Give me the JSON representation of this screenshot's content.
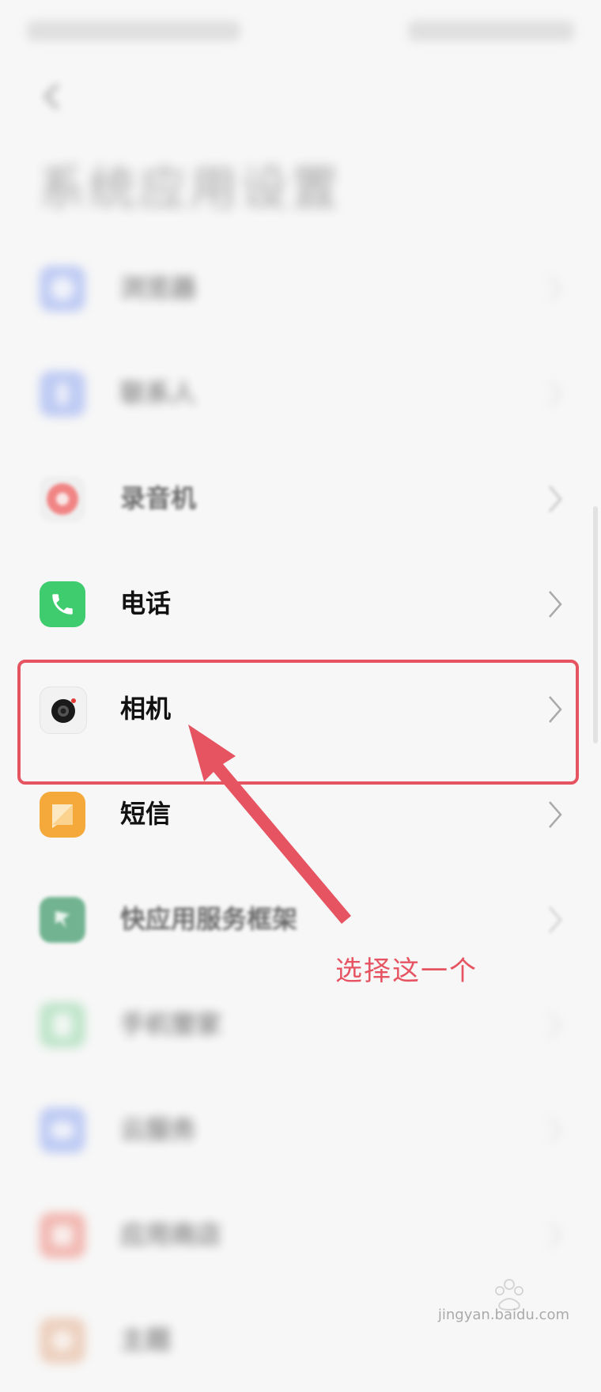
{
  "page": {
    "title": "系统应用设置"
  },
  "list": {
    "items": [
      {
        "label": "浏览器",
        "icon": "browser-icon",
        "color": "#6d8cf2"
      },
      {
        "label": "联系人",
        "icon": "contacts-icon",
        "color": "#6d8cf2"
      },
      {
        "label": "录音机",
        "icon": "recorder-icon",
        "color": "#f05a5a"
      },
      {
        "label": "电话",
        "icon": "phone-icon",
        "color": "#34c460"
      },
      {
        "label": "相机",
        "icon": "camera-icon",
        "color": "#1a1a1a"
      },
      {
        "label": "短信",
        "icon": "messages-icon",
        "color": "#f2a534"
      },
      {
        "label": "快应用服务框架",
        "icon": "quick-app-icon",
        "color": "#2e8b57"
      },
      {
        "label": "手机管家",
        "icon": "phone-manager-icon",
        "color": "#5cbf7a"
      },
      {
        "label": "云服务",
        "icon": "cloud-icon",
        "color": "#6d8cf2"
      },
      {
        "label": "应用商店",
        "icon": "app-store-icon",
        "color": "#e85a4a"
      },
      {
        "label": "主题",
        "icon": "theme-icon",
        "color": "#d98a5a"
      }
    ]
  },
  "annotation": {
    "text": "选择这一个",
    "color": "#e65462"
  },
  "watermark": {
    "text": "jingyan.baidu.com"
  }
}
